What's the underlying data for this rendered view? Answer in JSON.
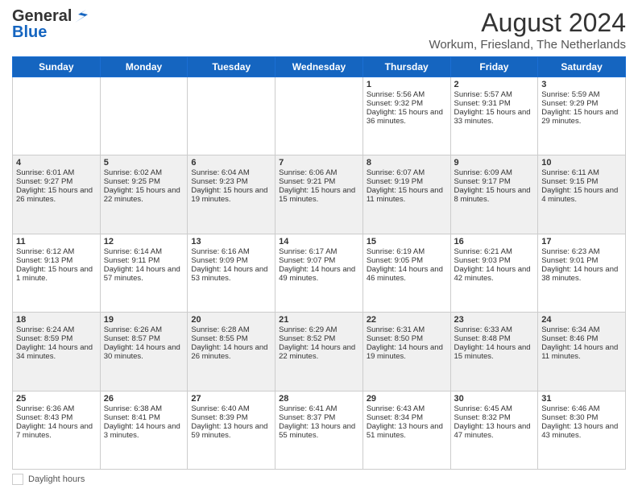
{
  "header": {
    "logo_general": "General",
    "logo_blue": "Blue",
    "month_year": "August 2024",
    "location": "Workum, Friesland, The Netherlands"
  },
  "days_of_week": [
    "Sunday",
    "Monday",
    "Tuesday",
    "Wednesday",
    "Thursday",
    "Friday",
    "Saturday"
  ],
  "weeks": [
    [
      {
        "day": "",
        "sunrise": "",
        "sunset": "",
        "daylight": "",
        "empty": true
      },
      {
        "day": "",
        "sunrise": "",
        "sunset": "",
        "daylight": "",
        "empty": true
      },
      {
        "day": "",
        "sunrise": "",
        "sunset": "",
        "daylight": "",
        "empty": true
      },
      {
        "day": "",
        "sunrise": "",
        "sunset": "",
        "daylight": "",
        "empty": true
      },
      {
        "day": "1",
        "sunrise": "Sunrise: 5:56 AM",
        "sunset": "Sunset: 9:32 PM",
        "daylight": "Daylight: 15 hours and 36 minutes.",
        "empty": false
      },
      {
        "day": "2",
        "sunrise": "Sunrise: 5:57 AM",
        "sunset": "Sunset: 9:31 PM",
        "daylight": "Daylight: 15 hours and 33 minutes.",
        "empty": false
      },
      {
        "day": "3",
        "sunrise": "Sunrise: 5:59 AM",
        "sunset": "Sunset: 9:29 PM",
        "daylight": "Daylight: 15 hours and 29 minutes.",
        "empty": false
      }
    ],
    [
      {
        "day": "4",
        "sunrise": "Sunrise: 6:01 AM",
        "sunset": "Sunset: 9:27 PM",
        "daylight": "Daylight: 15 hours and 26 minutes.",
        "empty": false
      },
      {
        "day": "5",
        "sunrise": "Sunrise: 6:02 AM",
        "sunset": "Sunset: 9:25 PM",
        "daylight": "Daylight: 15 hours and 22 minutes.",
        "empty": false
      },
      {
        "day": "6",
        "sunrise": "Sunrise: 6:04 AM",
        "sunset": "Sunset: 9:23 PM",
        "daylight": "Daylight: 15 hours and 19 minutes.",
        "empty": false
      },
      {
        "day": "7",
        "sunrise": "Sunrise: 6:06 AM",
        "sunset": "Sunset: 9:21 PM",
        "daylight": "Daylight: 15 hours and 15 minutes.",
        "empty": false
      },
      {
        "day": "8",
        "sunrise": "Sunrise: 6:07 AM",
        "sunset": "Sunset: 9:19 PM",
        "daylight": "Daylight: 15 hours and 11 minutes.",
        "empty": false
      },
      {
        "day": "9",
        "sunrise": "Sunrise: 6:09 AM",
        "sunset": "Sunset: 9:17 PM",
        "daylight": "Daylight: 15 hours and 8 minutes.",
        "empty": false
      },
      {
        "day": "10",
        "sunrise": "Sunrise: 6:11 AM",
        "sunset": "Sunset: 9:15 PM",
        "daylight": "Daylight: 15 hours and 4 minutes.",
        "empty": false
      }
    ],
    [
      {
        "day": "11",
        "sunrise": "Sunrise: 6:12 AM",
        "sunset": "Sunset: 9:13 PM",
        "daylight": "Daylight: 15 hours and 1 minute.",
        "empty": false
      },
      {
        "day": "12",
        "sunrise": "Sunrise: 6:14 AM",
        "sunset": "Sunset: 9:11 PM",
        "daylight": "Daylight: 14 hours and 57 minutes.",
        "empty": false
      },
      {
        "day": "13",
        "sunrise": "Sunrise: 6:16 AM",
        "sunset": "Sunset: 9:09 PM",
        "daylight": "Daylight: 14 hours and 53 minutes.",
        "empty": false
      },
      {
        "day": "14",
        "sunrise": "Sunrise: 6:17 AM",
        "sunset": "Sunset: 9:07 PM",
        "daylight": "Daylight: 14 hours and 49 minutes.",
        "empty": false
      },
      {
        "day": "15",
        "sunrise": "Sunrise: 6:19 AM",
        "sunset": "Sunset: 9:05 PM",
        "daylight": "Daylight: 14 hours and 46 minutes.",
        "empty": false
      },
      {
        "day": "16",
        "sunrise": "Sunrise: 6:21 AM",
        "sunset": "Sunset: 9:03 PM",
        "daylight": "Daylight: 14 hours and 42 minutes.",
        "empty": false
      },
      {
        "day": "17",
        "sunrise": "Sunrise: 6:23 AM",
        "sunset": "Sunset: 9:01 PM",
        "daylight": "Daylight: 14 hours and 38 minutes.",
        "empty": false
      }
    ],
    [
      {
        "day": "18",
        "sunrise": "Sunrise: 6:24 AM",
        "sunset": "Sunset: 8:59 PM",
        "daylight": "Daylight: 14 hours and 34 minutes.",
        "empty": false
      },
      {
        "day": "19",
        "sunrise": "Sunrise: 6:26 AM",
        "sunset": "Sunset: 8:57 PM",
        "daylight": "Daylight: 14 hours and 30 minutes.",
        "empty": false
      },
      {
        "day": "20",
        "sunrise": "Sunrise: 6:28 AM",
        "sunset": "Sunset: 8:55 PM",
        "daylight": "Daylight: 14 hours and 26 minutes.",
        "empty": false
      },
      {
        "day": "21",
        "sunrise": "Sunrise: 6:29 AM",
        "sunset": "Sunset: 8:52 PM",
        "daylight": "Daylight: 14 hours and 22 minutes.",
        "empty": false
      },
      {
        "day": "22",
        "sunrise": "Sunrise: 6:31 AM",
        "sunset": "Sunset: 8:50 PM",
        "daylight": "Daylight: 14 hours and 19 minutes.",
        "empty": false
      },
      {
        "day": "23",
        "sunrise": "Sunrise: 6:33 AM",
        "sunset": "Sunset: 8:48 PM",
        "daylight": "Daylight: 14 hours and 15 minutes.",
        "empty": false
      },
      {
        "day": "24",
        "sunrise": "Sunrise: 6:34 AM",
        "sunset": "Sunset: 8:46 PM",
        "daylight": "Daylight: 14 hours and 11 minutes.",
        "empty": false
      }
    ],
    [
      {
        "day": "25",
        "sunrise": "Sunrise: 6:36 AM",
        "sunset": "Sunset: 8:43 PM",
        "daylight": "Daylight: 14 hours and 7 minutes.",
        "empty": false
      },
      {
        "day": "26",
        "sunrise": "Sunrise: 6:38 AM",
        "sunset": "Sunset: 8:41 PM",
        "daylight": "Daylight: 14 hours and 3 minutes.",
        "empty": false
      },
      {
        "day": "27",
        "sunrise": "Sunrise: 6:40 AM",
        "sunset": "Sunset: 8:39 PM",
        "daylight": "Daylight: 13 hours and 59 minutes.",
        "empty": false
      },
      {
        "day": "28",
        "sunrise": "Sunrise: 6:41 AM",
        "sunset": "Sunset: 8:37 PM",
        "daylight": "Daylight: 13 hours and 55 minutes.",
        "empty": false
      },
      {
        "day": "29",
        "sunrise": "Sunrise: 6:43 AM",
        "sunset": "Sunset: 8:34 PM",
        "daylight": "Daylight: 13 hours and 51 minutes.",
        "empty": false
      },
      {
        "day": "30",
        "sunrise": "Sunrise: 6:45 AM",
        "sunset": "Sunset: 8:32 PM",
        "daylight": "Daylight: 13 hours and 47 minutes.",
        "empty": false
      },
      {
        "day": "31",
        "sunrise": "Sunrise: 6:46 AM",
        "sunset": "Sunset: 8:30 PM",
        "daylight": "Daylight: 13 hours and 43 minutes.",
        "empty": false
      }
    ]
  ],
  "footer": {
    "daylight_label": "Daylight hours"
  }
}
